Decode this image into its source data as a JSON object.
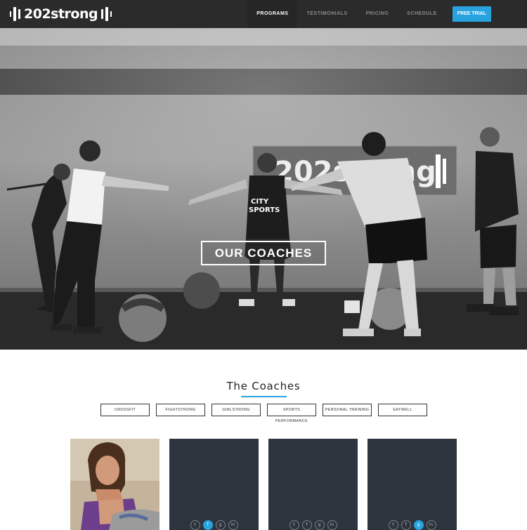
{
  "nav": {
    "logo": "202strong",
    "items": [
      {
        "label": "PROGRAMS",
        "active": true
      },
      {
        "label": "TESTIMONIALS",
        "active": false
      },
      {
        "label": "PRICING",
        "active": false
      },
      {
        "label": "SCHEDULE",
        "active": false
      }
    ],
    "cta": "FREE TRIAL"
  },
  "hero": {
    "button": "OUR COACHES",
    "wall_sign": "202strong"
  },
  "coaches": {
    "title": "The Coaches",
    "filters": [
      "CROSSFIT",
      "FIGHTSTRONG",
      "GIRLSTRONG",
      "SPORTS PERFORMANCE",
      "PERSONAL TRAINING",
      "EATWELL"
    ],
    "cards": [
      {
        "type": "photo",
        "socials": []
      },
      {
        "type": "placeholder",
        "socials": [
          "twitter-icon",
          "facebook-icon",
          "google-plus-icon",
          "linkedin-icon"
        ],
        "active": "facebook-icon"
      },
      {
        "type": "placeholder",
        "socials": [
          "twitter-icon",
          "facebook-icon",
          "google-plus-icon",
          "linkedin-icon"
        ],
        "active": ""
      },
      {
        "type": "placeholder",
        "socials": [
          "twitter-icon",
          "facebook-icon",
          "google-plus-icon",
          "linkedin-icon"
        ],
        "active": "google-plus-icon"
      }
    ]
  },
  "colors": {
    "nav_bg": "#2b2b2b",
    "accent": "#29a3e0",
    "card_bg": "#2e343d"
  }
}
